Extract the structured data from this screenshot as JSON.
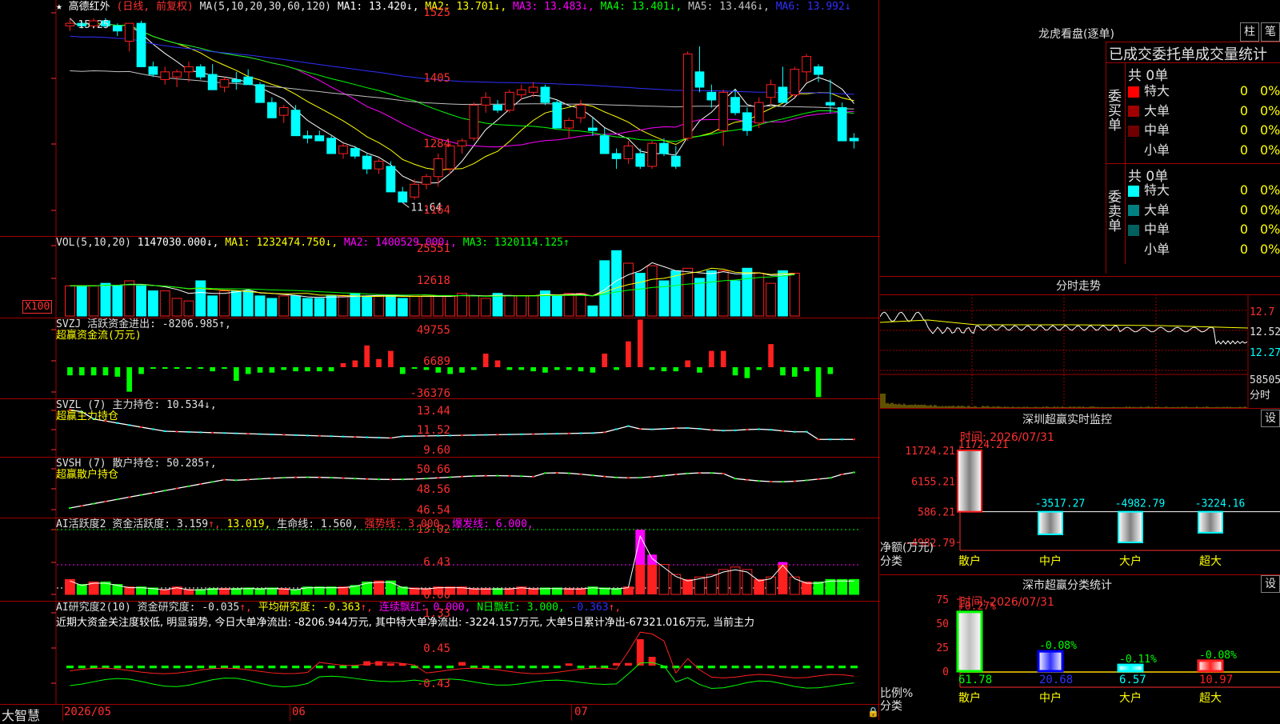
{
  "colors": {
    "up": "#ff2020",
    "down": "#00ffff",
    "ma1": "#ffffff",
    "ma2": "#ffff00",
    "ma3": "#ff00ff",
    "ma4": "#00ff00",
    "ma5": "#c0c0c0",
    "ma6": "#3030ff",
    "grid": "#a00000",
    "axis": "#ff3030"
  },
  "main": {
    "star": "★",
    "stock_name": "高德红外",
    "period": "(日线, 前复权)",
    "ma_label": "MA(5,10,20,30,60,120)",
    "ma_values": [
      {
        "text": "MA1: 13.420↓,",
        "color": "#ffffff"
      },
      {
        "text": "MA2: 13.701↓,",
        "color": "#ffff00"
      },
      {
        "text": "MA3: 13.483↓,",
        "color": "#ff00ff"
      },
      {
        "text": "MA4: 13.401↓,",
        "color": "#00ff00"
      },
      {
        "text": "MA5: 13.446↓,",
        "color": "#c0c0c0"
      },
      {
        "text": "MA6: 13.992↓",
        "color": "#3030ff"
      }
    ],
    "y_ticks": [
      "1525",
      "1405",
      "1284",
      "1164"
    ],
    "high_marker": "15.25",
    "low_marker": "11.64"
  },
  "vol": {
    "title": "VOL(5,10,20)",
    "value": "1147030.000↓,",
    "ma": [
      {
        "text": "MA1: 1232474.750↓,",
        "color": "#ffff00"
      },
      {
        "text": "MA2: 1400529.000↓,",
        "color": "#ff00ff"
      },
      {
        "text": "MA3: 1320114.125↑",
        "color": "#00ff00"
      }
    ],
    "y_ticks": [
      "25551",
      "12618"
    ],
    "unit_label": "X100",
    "volumes": [
      12,
      12,
      12,
      13,
      12,
      14,
      12,
      10,
      10,
      7,
      6,
      14,
      8,
      10,
      10,
      10,
      8,
      7,
      8,
      8,
      7,
      7,
      8,
      8,
      9,
      8,
      8,
      8,
      7,
      8,
      8,
      8,
      8,
      9,
      8,
      7,
      9,
      8,
      8,
      8,
      10,
      8,
      9,
      9,
      4,
      22,
      26,
      21,
      17,
      20,
      14,
      18,
      19,
      15,
      18,
      18,
      14,
      19,
      17,
      13,
      18,
      17
    ]
  },
  "flow": {
    "title": "SVZJ  活跃资金进出: -8206.985↑,",
    "sub": "超赢资金流(万元)",
    "y_ticks": [
      "49755",
      "6689",
      "-36376"
    ],
    "values": [
      -6,
      -6,
      -6,
      -6,
      -7,
      -18,
      -5,
      -1,
      -1,
      -1,
      -1,
      -1,
      -3,
      -1,
      -10,
      -5,
      -4,
      -4,
      -2,
      -3,
      -3,
      -3,
      -3,
      3,
      5,
      16,
      6,
      12,
      -5,
      -1,
      -2,
      -4,
      -5,
      -4,
      -2,
      10,
      5,
      -2,
      -2,
      -3,
      -4,
      -2,
      -2,
      -3,
      -4,
      10,
      -2,
      19,
      35,
      -2,
      -3,
      -3,
      5,
      -4,
      12,
      12,
      -6,
      -8,
      -2,
      17,
      -6,
      -7,
      -3,
      -22,
      -5
    ]
  },
  "zl": {
    "title": "SVZL (7) 主力持仓: 10.534↓,",
    "sub": "超赢主力持仓",
    "y_ticks": [
      "13.44",
      "11.52",
      "9.60"
    ]
  },
  "sh": {
    "title": "SVSH (7) 散户持仓: 50.285↑,",
    "sub": "超赢散户持仓",
    "y_ticks": [
      "50.66",
      "48.56",
      "46.54"
    ]
  },
  "act": {
    "title_parts": [
      {
        "text": "AI活跃度2 资金活跃度: 3.159",
        "color": "#e0e0e0"
      },
      {
        "text": "↑,",
        "color": "#ff3030"
      },
      {
        "text": " 13.019,",
        "color": "#ffff00"
      },
      {
        "text": " 生命线: 1.560,",
        "color": "#e0e0e0"
      },
      {
        "text": " 强势线: 3.000,",
        "color": "#ff3030"
      },
      {
        "text": " 爆发线: 6.000,",
        "color": "#ff00ff"
      }
    ],
    "y_ticks": [
      "13.02",
      "6.43",
      "0.00"
    ]
  },
  "res": {
    "title_parts": [
      {
        "text": "AI研究度2(10) 资金研究度: -0.035",
        "color": "#e0e0e0"
      },
      {
        "text": "↑,",
        "color": "#ff3030"
      },
      {
        "text": " 平均研究度: -0.363",
        "color": "#ffff00"
      },
      {
        "text": "↑,",
        "color": "#ff3030"
      },
      {
        "text": " 连续飘红: 0.000,",
        "color": "#ff00ff"
      },
      {
        "text": " N日飘红: 3.000,",
        "color": "#00ff00"
      },
      {
        "text": " -0.363",
        "color": "#3030ff"
      },
      {
        "text": "↑,",
        "color": "#ff3030"
      }
    ],
    "text": "近期大资金关注度较低, 明显弱势, 今日大单净流出: -8206.944万元, 其中特大单净流出: -3224.157万元, 大单5日累计净出-67321.016万元, 当前主力",
    "y_ticks": [
      "1.33",
      "0.45",
      "-0.43"
    ]
  },
  "footer": {
    "brand": "大智慧",
    "dates": [
      "2026/05",
      "06",
      "07"
    ]
  },
  "dragon": {
    "title": "龙虎看盘(逐单)",
    "btn1": "柱",
    "btn2": "笔",
    "tabs": "已成交委托单成交量统计",
    "buy_label": "委买单",
    "sell_label": "委卖单",
    "buy_total": "共 0单",
    "sell_total": "共 0单",
    "buy_rows": [
      {
        "label": "特大",
        "color": "#ff0000",
        "value": "0",
        "pct": "0%"
      },
      {
        "label": "大单",
        "color": "#a00000",
        "value": "0",
        "pct": "0%"
      },
      {
        "label": "中单",
        "color": "#700000",
        "value": "0",
        "pct": "0%"
      },
      {
        "label": "小单",
        "color": "#000000",
        "value": "0",
        "pct": "0%"
      }
    ],
    "sell_rows": [
      {
        "label": "特大",
        "color": "#00ffff",
        "value": "0",
        "pct": "0%"
      },
      {
        "label": "大单",
        "color": "#008080",
        "value": "0",
        "pct": "0%"
      },
      {
        "label": "中单",
        "color": "#006060",
        "value": "0",
        "pct": "0%"
      },
      {
        "label": "小单",
        "color": "#000000",
        "value": "0",
        "pct": "0%"
      }
    ]
  },
  "intraday": {
    "title": "分时走势",
    "y_ticks": [
      "12.7",
      "12.52",
      "12.27"
    ],
    "vol_tick": "58505",
    "unit": "分时"
  },
  "sz_monitor": {
    "title": "深圳超赢实时监控",
    "set": "设",
    "time": "时间: 2026/07/31",
    "top_value": "11724.21",
    "y_ticks": [
      "11724.21",
      "6155.21",
      "586.21",
      "-4982.79"
    ],
    "y_label": "净额(万元)",
    "x_label": "分类",
    "bars": [
      {
        "name": "散户",
        "value": 11724.21,
        "label": "11724.21",
        "color": "#ff2020"
      },
      {
        "name": "中户",
        "value": -3517.27,
        "label": "-3517.27",
        "color": "#00ffff"
      },
      {
        "name": "大户",
        "value": -4982.79,
        "label": "-4982.79",
        "color": "#00ffff"
      },
      {
        "name": "超大",
        "value": -3224.16,
        "label": "-3224.16",
        "color": "#00ffff"
      }
    ]
  },
  "sz_class": {
    "title": "深市超赢分类统计",
    "set": "设",
    "time": "时间: 2026/07/31",
    "y_ticks": [
      "75",
      "50",
      "25",
      "0"
    ],
    "y_label": "比例%",
    "x_label": "分类",
    "bars": [
      {
        "name": "散户",
        "ratio": 61.78,
        "value": "61.78",
        "change": "+0.27%",
        "color": "#00ff00",
        "fill": "#c0c0c0",
        "name_color": "#ffff00",
        "val_color": "#00ff00"
      },
      {
        "name": "中户",
        "ratio": 20.68,
        "value": "20.68",
        "change": "-0.08%",
        "color": "#0000ff",
        "fill": "#3030ff",
        "name_color": "#ffff00",
        "val_color": "#3030ff"
      },
      {
        "name": "大户",
        "ratio": 6.57,
        "value": "6.57",
        "change": "-0.11%",
        "color": "#00ffff",
        "fill": "#00ffff",
        "name_color": "#ffff00",
        "val_color": "#00ffff"
      },
      {
        "name": "超大",
        "ratio": 10.97,
        "value": "10.97",
        "change": "-0.08%",
        "color": "#ff2020",
        "fill": "#ff2020",
        "name_color": "#ffff00",
        "val_color": "#ff2020"
      }
    ]
  },
  "candles": [
    [
      15.1,
      15.25,
      15.0,
      15.15
    ],
    [
      15.15,
      15.2,
      15.05,
      15.1
    ],
    [
      15.1,
      15.25,
      15.05,
      15.2
    ],
    [
      15.2,
      15.25,
      15.05,
      15.1
    ],
    [
      15.1,
      15.15,
      14.9,
      15.0
    ],
    [
      14.8,
      15.15,
      14.6,
      15.15
    ],
    [
      15.15,
      15.2,
      14.3,
      14.3
    ],
    [
      14.3,
      14.4,
      14.1,
      14.15
    ],
    [
      14.05,
      14.3,
      13.95,
      14.2
    ],
    [
      14.1,
      14.25,
      13.9,
      14.2
    ],
    [
      14.2,
      14.4,
      14.0,
      14.3
    ],
    [
      14.3,
      14.35,
      14.05,
      14.1
    ],
    [
      14.15,
      14.35,
      13.85,
      13.85
    ],
    [
      13.9,
      14.1,
      13.8,
      14.05
    ],
    [
      14.05,
      14.2,
      13.85,
      14.0
    ],
    [
      14.1,
      14.25,
      13.95,
      13.95
    ],
    [
      13.95,
      14.0,
      13.6,
      13.6
    ],
    [
      13.6,
      13.7,
      13.3,
      13.3
    ],
    [
      13.35,
      13.55,
      13.2,
      13.5
    ],
    [
      13.45,
      13.55,
      12.95,
      12.95
    ],
    [
      12.95,
      13.05,
      12.8,
      12.9
    ],
    [
      12.95,
      13.05,
      12.85,
      12.85
    ],
    [
      12.9,
      12.95,
      12.6,
      12.6
    ],
    [
      12.6,
      12.8,
      12.5,
      12.75
    ],
    [
      12.7,
      12.75,
      12.5,
      12.55
    ],
    [
      12.55,
      12.6,
      12.2,
      12.3
    ],
    [
      12.3,
      12.5,
      12.2,
      12.45
    ],
    [
      12.35,
      12.45,
      11.85,
      11.85
    ],
    [
      11.85,
      11.95,
      11.64,
      11.65
    ],
    [
      11.75,
      12.1,
      11.7,
      12.0
    ],
    [
      12.0,
      12.2,
      11.9,
      12.15
    ],
    [
      12.15,
      12.6,
      11.95,
      12.5
    ],
    [
      12.3,
      12.8,
      12.2,
      12.75
    ],
    [
      12.75,
      12.9,
      12.6,
      12.85
    ],
    [
      12.9,
      13.6,
      12.85,
      13.55
    ],
    [
      13.55,
      13.8,
      13.4,
      13.7
    ],
    [
      13.55,
      13.65,
      13.4,
      13.45
    ],
    [
      13.45,
      13.85,
      13.4,
      13.8
    ],
    [
      13.75,
      13.95,
      13.65,
      13.85
    ],
    [
      13.8,
      14.0,
      13.7,
      13.9
    ],
    [
      13.9,
      13.95,
      13.55,
      13.6
    ],
    [
      13.6,
      13.65,
      13.1,
      13.1
    ],
    [
      13.1,
      13.3,
      12.9,
      13.25
    ],
    [
      13.3,
      13.65,
      13.2,
      13.55
    ],
    [
      13.1,
      13.3,
      12.95,
      13.05
    ],
    [
      12.95,
      13.1,
      12.6,
      12.6
    ],
    [
      12.6,
      12.7,
      12.3,
      12.5
    ],
    [
      12.5,
      12.85,
      12.4,
      12.75
    ],
    [
      12.6,
      12.7,
      12.3,
      12.35
    ],
    [
      12.35,
      12.85,
      12.3,
      12.8
    ],
    [
      12.8,
      12.9,
      12.55,
      12.6
    ],
    [
      12.55,
      12.75,
      12.3,
      12.35
    ],
    [
      12.9,
      14.6,
      12.85,
      14.55
    ],
    [
      14.2,
      14.7,
      13.8,
      13.9
    ],
    [
      13.8,
      13.95,
      13.5,
      13.65
    ],
    [
      13.05,
      13.85,
      12.75,
      13.8
    ],
    [
      13.7,
      13.85,
      13.35,
      13.4
    ],
    [
      13.4,
      13.5,
      12.95,
      13.05
    ],
    [
      13.2,
      13.7,
      13.1,
      13.6
    ],
    [
      13.7,
      14.05,
      13.55,
      13.95
    ],
    [
      13.9,
      14.3,
      13.6,
      13.6
    ],
    [
      13.75,
      14.3,
      13.7,
      14.25
    ],
    [
      14.2,
      14.55,
      14.0,
      14.5
    ],
    [
      14.3,
      14.35,
      14.0,
      14.15
    ],
    [
      13.6,
      14.05,
      13.4,
      13.55
    ],
    [
      13.5,
      13.6,
      12.85,
      12.85
    ],
    [
      12.9,
      13.0,
      12.7,
      12.85
    ]
  ]
}
